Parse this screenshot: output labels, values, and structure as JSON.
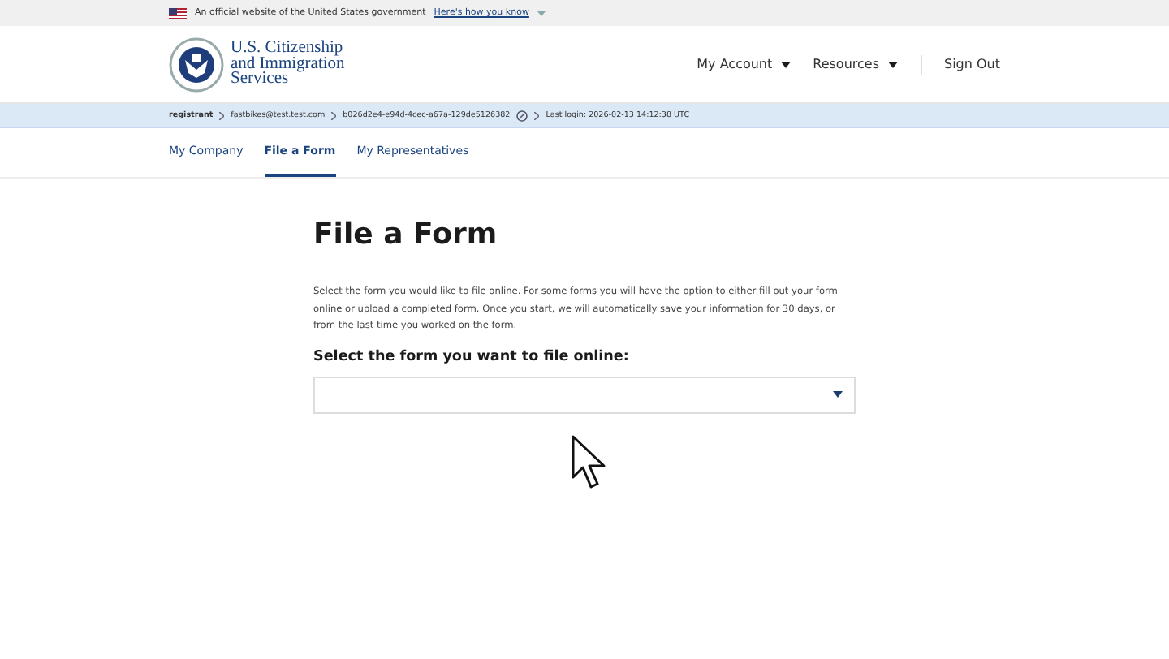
{
  "banner": {
    "text": "An official website of the United States government",
    "link": "Here's how you know"
  },
  "header": {
    "agency": [
      "U.S. Citizenship",
      "and Immigration",
      "Services"
    ],
    "nav": [
      {
        "label": "My Account",
        "kind": "dropdown"
      },
      {
        "label": "Resources",
        "kind": "dropdown"
      },
      {
        "label": "Sign Out",
        "kind": "link"
      }
    ]
  },
  "info_bar": [
    {
      "text": "registrant",
      "kind": "role"
    },
    {
      "text": "fastbikes@test.test.com",
      "kind": "plain"
    },
    {
      "text": "b026d2e4-e94d-4cec-a67a-129de5126382",
      "kind": "copyable"
    },
    {
      "text": "Last login: 2026-02-13 14:12:38 UTC",
      "kind": "plain"
    }
  ],
  "tabs": [
    {
      "label": "My Company",
      "selected": false
    },
    {
      "label": "File a Form",
      "selected": true
    },
    {
      "label": "My Representatives",
      "selected": false
    }
  ],
  "page": {
    "title": "File a Form",
    "description": "Select the form you would like to file online. For some forms you will have the option to either fill out your form online or upload a completed form. Once you start, we will automatically save your information for 30 days, or from the last time you worked on the form.",
    "select_label": "Select the form you want to file online:"
  }
}
